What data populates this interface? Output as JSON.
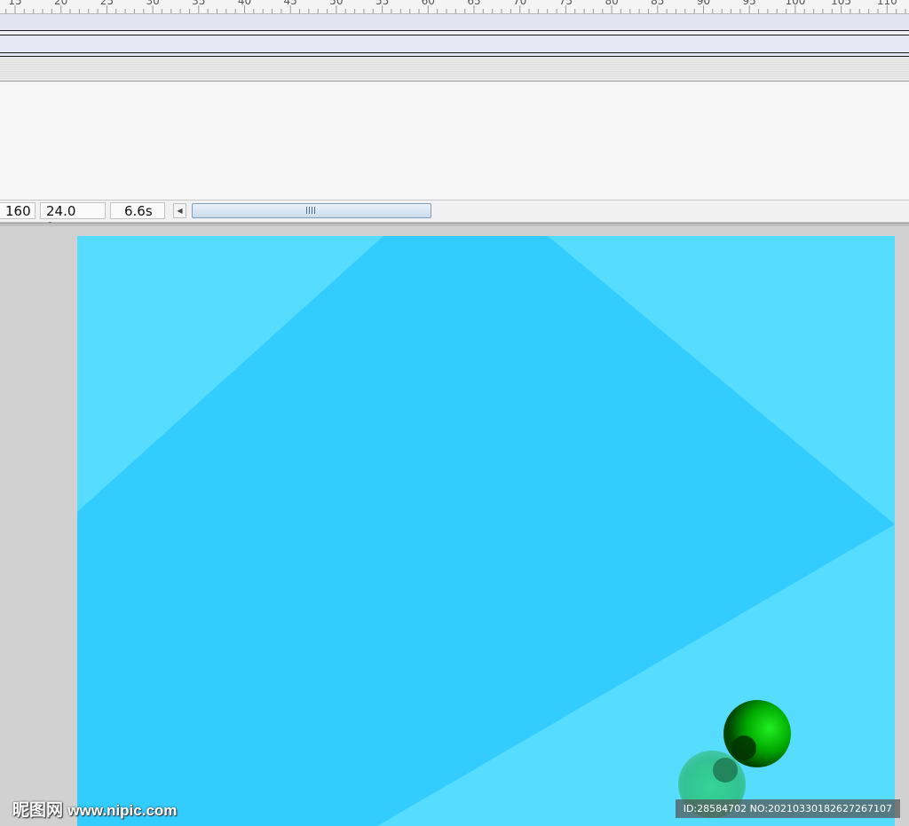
{
  "timeline": {
    "ruler_labels": [
      "15",
      "20",
      "25",
      "30",
      "35",
      "40",
      "45",
      "50",
      "55",
      "60",
      "65",
      "70",
      "75",
      "80",
      "85",
      "90",
      "95",
      "100",
      "105",
      "110"
    ],
    "current_frame": "160",
    "frame_rate": "24.0 fps",
    "elapsed_time": "6.6s"
  },
  "stage": {
    "background_color": "#55dcff",
    "shape_color": "#33ccff",
    "balls": [
      {
        "name": "green-ball",
        "color": "#00cc00"
      },
      {
        "name": "teal-ball",
        "color": "#33cc88"
      }
    ]
  },
  "watermark": {
    "site_name": "昵图网",
    "site_url": "www.nipic.com",
    "id_text": "ID:28584702 NO:20210330182627267107"
  }
}
